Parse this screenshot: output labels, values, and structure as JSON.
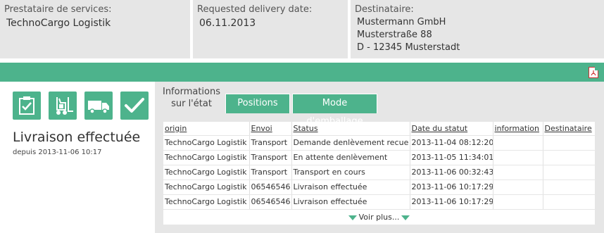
{
  "provider": {
    "label": "Prestataire de services:",
    "value": "TechnoCargo Logistik"
  },
  "delivery": {
    "label": "Requested delivery date:",
    "value": "06.11.2013"
  },
  "recipient": {
    "label": "Destinataire:",
    "lines": [
      "Mustermann GmbH",
      "Musterstraße 88",
      "D - 12345 Musterstadt"
    ]
  },
  "header": {
    "pdf_icon": "pdf-icon"
  },
  "status": {
    "icons": [
      "clipboard-check-icon",
      "forklift-icon",
      "truck-icon",
      "checkmark-icon"
    ],
    "title": "Livraison effectuée",
    "since": "depuis 2013-11-06 10:17"
  },
  "tabs": [
    {
      "label_line1": "Informations",
      "label_line2": "sur l'état"
    },
    {
      "label": "Positions"
    },
    {
      "label": "Mode d'emballage"
    }
  ],
  "table": {
    "columns": [
      "origin",
      "Envoi",
      "Status",
      "Date du statut",
      "information",
      "Destinataire"
    ],
    "rows": [
      [
        "TechnoCargo Logistik",
        "Transport",
        "Demande denlèvement recue",
        "2013-11-04 08:12:20",
        "",
        ""
      ],
      [
        "TechnoCargo Logistik",
        "Transport",
        "En attente denlèvement",
        "2013-11-05 11:34:01",
        "",
        ""
      ],
      [
        "TechnoCargo Logistik",
        "Transport",
        "Transport en cours",
        "2013-11-06 00:32:43",
        "",
        ""
      ],
      [
        "TechnoCargo Logistik",
        "06546546",
        "Livraison effectuée",
        "2013-11-06 10:17:29",
        "",
        ""
      ],
      [
        "TechnoCargo Logistik",
        "06546546",
        "Livraison effectuée",
        "2013-11-06 10:17:29",
        "",
        ""
      ]
    ]
  },
  "more_label": "Voir plus...",
  "colors": {
    "accent": "#4db38c",
    "panel": "#e6e6e6"
  }
}
